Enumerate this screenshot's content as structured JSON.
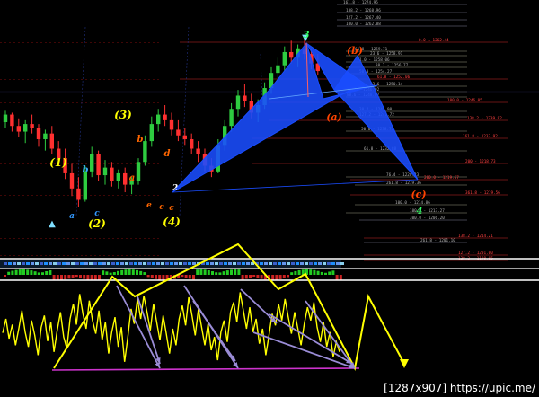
{
  "chart_data": {
    "type": "candlestick-with-indicator",
    "candles": [
      [
        1245,
        1251,
        1242,
        1249
      ],
      [
        1249,
        1250,
        1240,
        1243
      ],
      [
        1243,
        1247,
        1237,
        1240
      ],
      [
        1240,
        1246,
        1234,
        1244
      ],
      [
        1244,
        1249,
        1239,
        1242
      ],
      [
        1242,
        1244,
        1232,
        1236
      ],
      [
        1236,
        1241,
        1230,
        1239
      ],
      [
        1239,
        1243,
        1228,
        1231
      ],
      [
        1231,
        1235,
        1222,
        1226
      ],
      [
        1226,
        1231,
        1215,
        1218
      ],
      [
        1218,
        1223,
        1206,
        1210
      ],
      [
        1210,
        1216,
        1200,
        1204
      ],
      [
        1204,
        1222,
        1203,
        1219
      ],
      [
        1219,
        1232,
        1216,
        1228
      ],
      [
        1228,
        1230,
        1214,
        1217
      ],
      [
        1217,
        1225,
        1212,
        1221
      ],
      [
        1221,
        1224,
        1211,
        1214
      ],
      [
        1214,
        1220,
        1210,
        1218
      ],
      [
        1218,
        1221,
        1208,
        1212
      ],
      [
        1212,
        1216,
        1207,
        1214
      ],
      [
        1214,
        1226,
        1212,
        1224
      ],
      [
        1224,
        1238,
        1222,
        1235
      ],
      [
        1235,
        1248,
        1232,
        1244
      ],
      [
        1244,
        1252,
        1240,
        1249
      ],
      [
        1249,
        1254,
        1243,
        1246
      ],
      [
        1246,
        1250,
        1238,
        1241
      ],
      [
        1241,
        1246,
        1235,
        1238
      ],
      [
        1238,
        1242,
        1233,
        1236
      ],
      [
        1236,
        1239,
        1228,
        1231
      ],
      [
        1231,
        1235,
        1224,
        1228
      ],
      [
        1228,
        1231,
        1219,
        1222
      ],
      [
        1222,
        1226,
        1216,
        1219
      ],
      [
        1219,
        1236,
        1218,
        1233
      ],
      [
        1233,
        1246,
        1230,
        1243
      ],
      [
        1243,
        1255,
        1240,
        1252
      ],
      [
        1252,
        1262,
        1248,
        1259
      ],
      [
        1259,
        1265,
        1253,
        1256
      ],
      [
        1256,
        1260,
        1247,
        1250
      ],
      [
        1250,
        1257,
        1245,
        1254
      ],
      [
        1254,
        1266,
        1252,
        1263
      ],
      [
        1263,
        1274,
        1260,
        1271
      ],
      [
        1271,
        1279,
        1266,
        1275
      ],
      [
        1275,
        1285,
        1272,
        1282
      ],
      [
        1282,
        1288,
        1276,
        1279
      ],
      [
        1279,
        1286,
        1274,
        1284
      ],
      [
        1284,
        1289,
        1278,
        1281
      ],
      [
        1281,
        1284,
        1273,
        1276
      ],
      [
        1276,
        1281,
        1270,
        1272
      ]
    ],
    "waves": [
      {
        "label": "(1)",
        "color": "#ffff00"
      },
      {
        "label": "b",
        "color": "#33aaff"
      },
      {
        "label": "a",
        "color": "#3399ff"
      },
      {
        "label": "c",
        "color": "#3399ff"
      },
      {
        "label": "(2)",
        "color": "#ffff00"
      },
      {
        "label": "(3)",
        "color": "#ffff00"
      },
      {
        "label": "b",
        "color": "#ff6600"
      },
      {
        "label": "a",
        "color": "#ff6600"
      },
      {
        "label": "d",
        "color": "#ff6600"
      },
      {
        "label": "c",
        "color": "#ff6600"
      },
      {
        "label": "e",
        "color": "#ff6600"
      },
      {
        "label": "c",
        "color": "#ff6600"
      },
      {
        "label": "(4)",
        "color": "#ffff00"
      },
      {
        "label": "3",
        "color": "#33ff66"
      },
      {
        "label": "(b)",
        "color": "#ff4400"
      },
      {
        "label": "(a)",
        "color": "#ff4400"
      },
      {
        "label": "(c)",
        "color": "#ff4400"
      },
      {
        "label": "4",
        "color": "#33ff66"
      },
      {
        "label": "2",
        "color": "#ffffff"
      }
    ],
    "fib_labels": [
      "161.8 - 1274.95",
      "138.2 - 1268.96",
      "127.2 - 1267.40",
      "100.0 - 1262.88",
      "0.0 = 1262.44",
      "61.8 - 1259.71",
      "23.6 - 1258.91",
      "1.0 - 1258.06",
      "38.2 - 1256.77",
      "50.0 - 1254.27",
      "61.8 - 1252.06",
      "23.6 - 1250.14",
      "76.4 - 1246.92",
      "88.6 - 1248.07",
      "100.0 - 1246.05",
      "38.2 - 1245.90",
      "127.2 - 1241.72",
      "138.2 - 1239.92",
      "50.0 - 1238.75",
      "161.8 - 1233.92",
      "61.8 - 1232.88",
      "200 - 1218.73",
      "76.4 - 1220.23",
      "200.0 - 1219.67",
      "261.8 - 1219.36",
      "361.8 - 1219.56",
      "100.0 - 1214.86",
      "100.0 - 1213.27",
      "300.0 - 1206.20",
      "138.2 - 1214.21",
      "261.8 - 1201.10",
      "127.2 - 1201.00",
      "138.2 - 1198.05"
    ],
    "oscillator": [
      0.45,
      0.62,
      0.38,
      0.55,
      0.3,
      0.5,
      0.72,
      0.46,
      0.28,
      0.6,
      0.42,
      0.18,
      0.52,
      0.66,
      0.35,
      0.58,
      0.22,
      0.48,
      0.7,
      0.4,
      0.26,
      0.62,
      0.8,
      0.55,
      0.92,
      0.68,
      0.5,
      0.84,
      0.6,
      0.44,
      0.72,
      0.36,
      0.58,
      0.2,
      0.46,
      0.64,
      0.28,
      0.52,
      0.1,
      0.4,
      0.74,
      0.56,
      0.86,
      0.62,
      0.9,
      0.7,
      0.48,
      0.8,
      0.58,
      0.36,
      0.66,
      0.44,
      0.2,
      0.5,
      0.3,
      0.62,
      0.78,
      0.54,
      0.88,
      0.66,
      0.42,
      0.74,
      0.52,
      0.3,
      0.56,
      0.24,
      0.4,
      0.12,
      0.46,
      0.6,
      0.34,
      0.7,
      0.82,
      0.58,
      0.94,
      0.72,
      0.5,
      0.76,
      0.46,
      0.62,
      0.32,
      0.5,
      0.18,
      0.42,
      0.68,
      0.54,
      0.8,
      0.6,
      0.86,
      0.64,
      0.44,
      0.7,
      0.5,
      0.3,
      0.56,
      0.76,
      0.6,
      0.82,
      0.52,
      0.34,
      0.58,
      0.28,
      0.46,
      0.16,
      0.34,
      0.22
    ]
  },
  "watermark": "[1287x907] https://upic.me/",
  "colors": {
    "pattern": "#1a4dff",
    "bull": "#2ecc40",
    "bear": "#ff3030",
    "trend": "#ffff00",
    "arrows": "#9a8cd6",
    "osc": "#ffff00",
    "fib": "#8b1a1a"
  }
}
